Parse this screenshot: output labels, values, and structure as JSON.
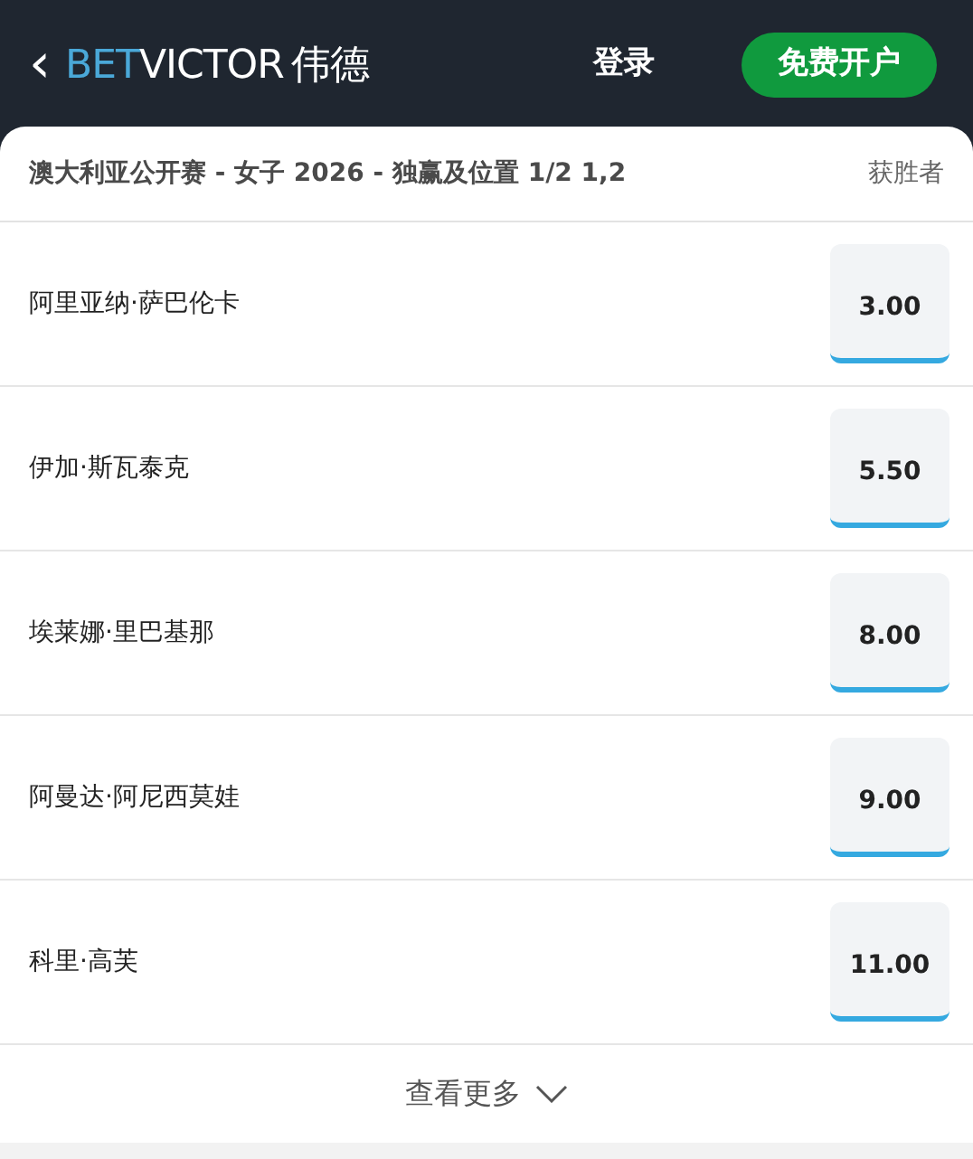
{
  "header": {
    "back_icon": "‹",
    "logo": {
      "part_1": "BET",
      "part_2": "VICTOR",
      "suffix": "伟德"
    },
    "login": "登录",
    "signup": "免费开户"
  },
  "market": {
    "title": "澳大利亚公开赛 - 女子 2026 - 独赢及位置 1/2 1,2",
    "type": "获胜者"
  },
  "selections": [
    {
      "name": "阿里亚纳·萨巴伦卡",
      "odds": "3.00"
    },
    {
      "name": "伊加·斯瓦泰克",
      "odds": "5.50"
    },
    {
      "name": "埃莱娜·里巴基那",
      "odds": "8.00"
    },
    {
      "name": "阿曼达·阿尼西莫娃",
      "odds": "9.00"
    },
    {
      "name": "科里·高芙",
      "odds": "11.00"
    }
  ],
  "see_more": "查看更多"
}
